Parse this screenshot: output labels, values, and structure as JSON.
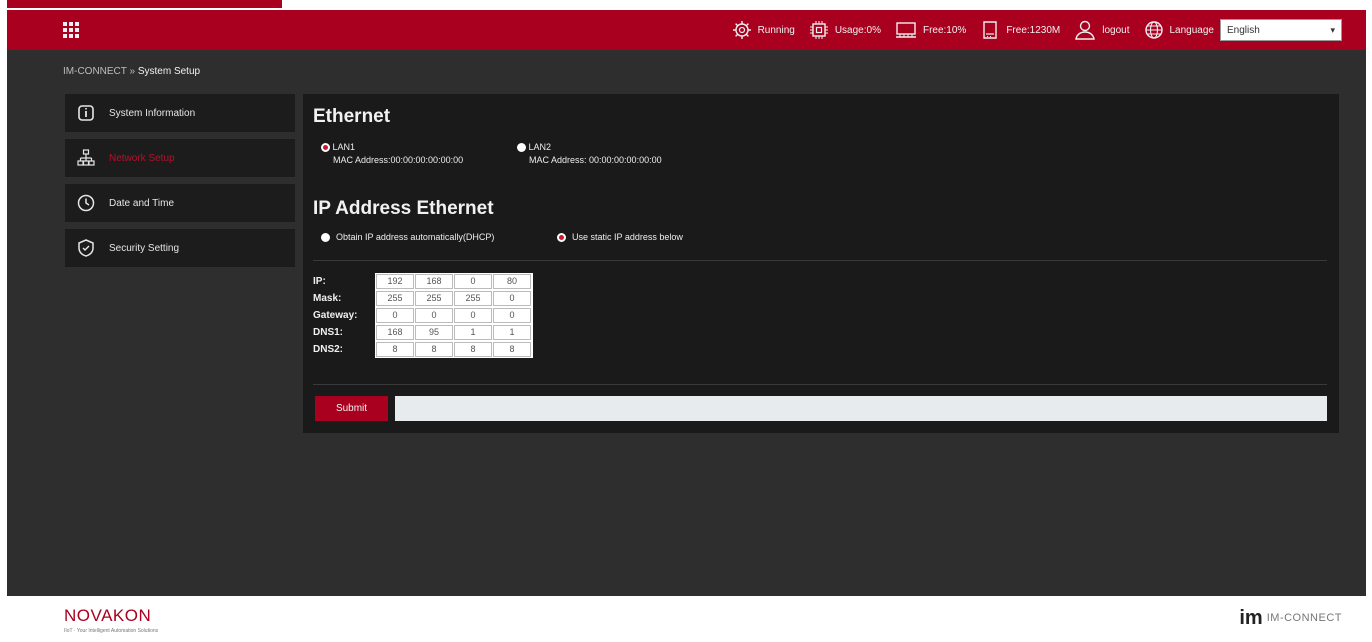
{
  "header": {
    "status": [
      {
        "icon": "gear-icon",
        "label": "Running"
      },
      {
        "icon": "cpu-icon",
        "label": "Usage:0%"
      },
      {
        "icon": "memory-icon",
        "label": "Free:10%"
      },
      {
        "icon": "storage-icon",
        "label": "Free:1230M"
      },
      {
        "icon": "user-icon",
        "label": "logout"
      },
      {
        "icon": "globe-icon",
        "label": "Language"
      }
    ],
    "language_selected": "English"
  },
  "breadcrumb": {
    "root": "IM-CONNECT",
    "separator": "»",
    "current": "System Setup"
  },
  "sidebar": {
    "items": [
      {
        "icon": "info-icon",
        "label": "System Information"
      },
      {
        "icon": "network-icon",
        "label": "Network Setup",
        "active": true
      },
      {
        "icon": "clock-icon",
        "label": "Date and Time"
      },
      {
        "icon": "shield-icon",
        "label": "Security Setting"
      }
    ]
  },
  "ethernet": {
    "title": "Ethernet",
    "lan1": {
      "label": "LAN1",
      "mac": "MAC Address:00:00:00:00:00:00",
      "selected": true
    },
    "lan2": {
      "label": "LAN2",
      "mac": "MAC Address: 00:00:00:00:00:00",
      "selected": false
    }
  },
  "ip_ethernet": {
    "title": "IP Address Ethernet",
    "dhcp_label": "Obtain IP address automatically(DHCP)",
    "static_label": "Use static IP address below",
    "mode": "static"
  },
  "ip_config": [
    {
      "label": "IP:",
      "octets": [
        "192",
        "168",
        "0",
        "80"
      ]
    },
    {
      "label": "Mask:",
      "octets": [
        "255",
        "255",
        "255",
        "0"
      ]
    },
    {
      "label": "Gateway:",
      "octets": [
        "0",
        "0",
        "0",
        "0"
      ]
    },
    {
      "label": "DNS1:",
      "octets": [
        "168",
        "95",
        "1",
        "1"
      ]
    },
    {
      "label": "DNS2:",
      "octets": [
        "8",
        "8",
        "8",
        "8"
      ]
    }
  ],
  "submit_label": "Submit",
  "footer": {
    "brand": "NOVAKON",
    "tagline": "IIoT · Your Intelligent Automation Solutions",
    "product": "IM-CONNECT",
    "product_mark": "im"
  },
  "colors": {
    "accent": "#a8001e",
    "panel": "#1a1a1a",
    "background": "#2e2e2e"
  }
}
